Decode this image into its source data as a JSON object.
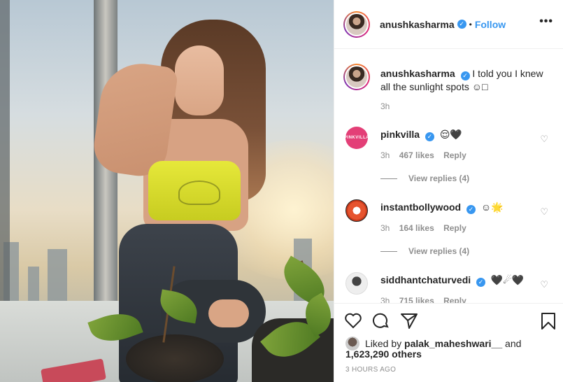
{
  "header": {
    "username": "anushkasharma",
    "separator": "•",
    "follow_label": "Follow",
    "more_icon": "more-options-icon",
    "more_glyph": "•••"
  },
  "caption": {
    "username": "anushkasharma",
    "text": "I told you I knew all the sunlight spots ☺□",
    "time": "3h"
  },
  "comments": [
    {
      "username": "pinkvilla",
      "avatar_text": "PINKVILLA",
      "emoji": "😌🖤",
      "time": "3h",
      "likes": "467 likes",
      "reply_label": "Reply",
      "view_replies": "View replies (4)"
    },
    {
      "username": "instantbollywood",
      "emoji": "☺🌟",
      "time": "3h",
      "likes": "164 likes",
      "reply_label": "Reply",
      "view_replies": "View replies (4)"
    },
    {
      "username": "siddhantchaturvedi",
      "emoji": "🖤☄🖤",
      "time": "3h",
      "likes": "715 likes",
      "reply_label": "Reply"
    }
  ],
  "actions": {
    "like_icon": "heart-icon",
    "comment_icon": "comment-icon",
    "share_icon": "share-icon",
    "save_icon": "bookmark-icon"
  },
  "likes_summary": {
    "prefix": "Liked by",
    "liker": "palak_maheshwari__",
    "conjunction": "and",
    "others": "1,623,290 others"
  },
  "posted_ago": "3 HOURS AGO",
  "colors": {
    "link_blue": "#3897f0",
    "muted": "#8e8e8e",
    "text": "#262626",
    "verified": "#3897f0"
  }
}
